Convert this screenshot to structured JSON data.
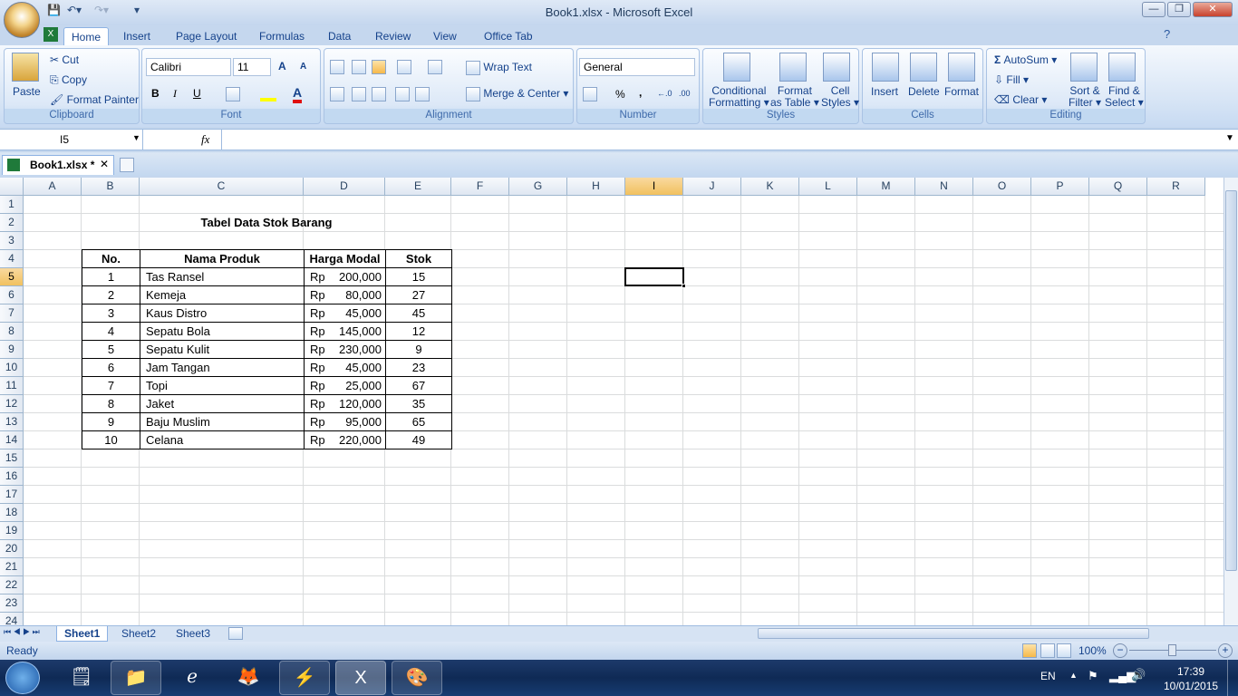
{
  "window": {
    "title": "Book1.xlsx - Microsoft Excel"
  },
  "ribbon_tabs": [
    "Home",
    "Insert",
    "Page Layout",
    "Formulas",
    "Data",
    "Review",
    "View",
    "Office Tab"
  ],
  "clipboard": {
    "paste": "Paste",
    "cut": "Cut",
    "copy": "Copy",
    "format_painter": "Format Painter",
    "label": "Clipboard"
  },
  "font": {
    "name": "Calibri",
    "size": "11",
    "bold": "B",
    "italic": "I",
    "underline": "U",
    "grow": "A",
    "shrink": "A",
    "label": "Font"
  },
  "alignment": {
    "wrap": "Wrap Text",
    "merge": "Merge & Center",
    "label": "Alignment"
  },
  "number": {
    "format": "General",
    "percent": "%",
    "comma": ",",
    "inc": "←.0",
    "dec": ".00",
    "label": "Number"
  },
  "styles": {
    "conditional": "Conditional",
    "conditional2": "Formatting",
    "format_table": "Format",
    "format_table2": "as Table",
    "cell_styles": "Cell",
    "cell_styles2": "Styles",
    "label": "Styles"
  },
  "cells": {
    "insert": "Insert",
    "delete": "Delete",
    "format": "Format",
    "label": "Cells"
  },
  "editing": {
    "autosum": "AutoSum",
    "fill": "Fill",
    "clear": "Clear",
    "sort": "Sort &",
    "sort2": "Filter",
    "find": "Find &",
    "find2": "Select",
    "label": "Editing"
  },
  "formula_bar": {
    "name_box": "I5",
    "fx": "fx",
    "value": ""
  },
  "doc_tab": {
    "name": "Book1.xlsx *"
  },
  "columns": [
    "A",
    "B",
    "C",
    "D",
    "E",
    "F",
    "G",
    "H",
    "I",
    "J",
    "K",
    "L",
    "M",
    "N",
    "O",
    "P",
    "Q",
    "R"
  ],
  "selected_cell": "I5",
  "sheet": {
    "title": "Tabel Data Stok Barang",
    "headers": [
      "No.",
      "Nama Produk",
      "Harga Modal",
      "Stok"
    ],
    "currency": "Rp",
    "rows": [
      [
        "1",
        "Tas Ransel",
        "200,000",
        "15"
      ],
      [
        "2",
        "Kemeja",
        "80,000",
        "27"
      ],
      [
        "3",
        "Kaus Distro",
        "45,000",
        "45"
      ],
      [
        "4",
        "Sepatu Bola",
        "145,000",
        "12"
      ],
      [
        "5",
        "Sepatu Kulit",
        "230,000",
        "9"
      ],
      [
        "6",
        "Jam Tangan",
        "45,000",
        "23"
      ],
      [
        "7",
        "Topi",
        "25,000",
        "67"
      ],
      [
        "8",
        "Jaket",
        "120,000",
        "35"
      ],
      [
        "9",
        "Baju Muslim",
        "95,000",
        "65"
      ],
      [
        "10",
        "Celana",
        "220,000",
        "49"
      ]
    ]
  },
  "sheet_tabs": [
    "Sheet1",
    "Sheet2",
    "Sheet3"
  ],
  "status": {
    "ready": "Ready",
    "zoom": "100%"
  },
  "tray": {
    "lang": "EN",
    "time": "17:39",
    "date": "10/01/2015"
  }
}
